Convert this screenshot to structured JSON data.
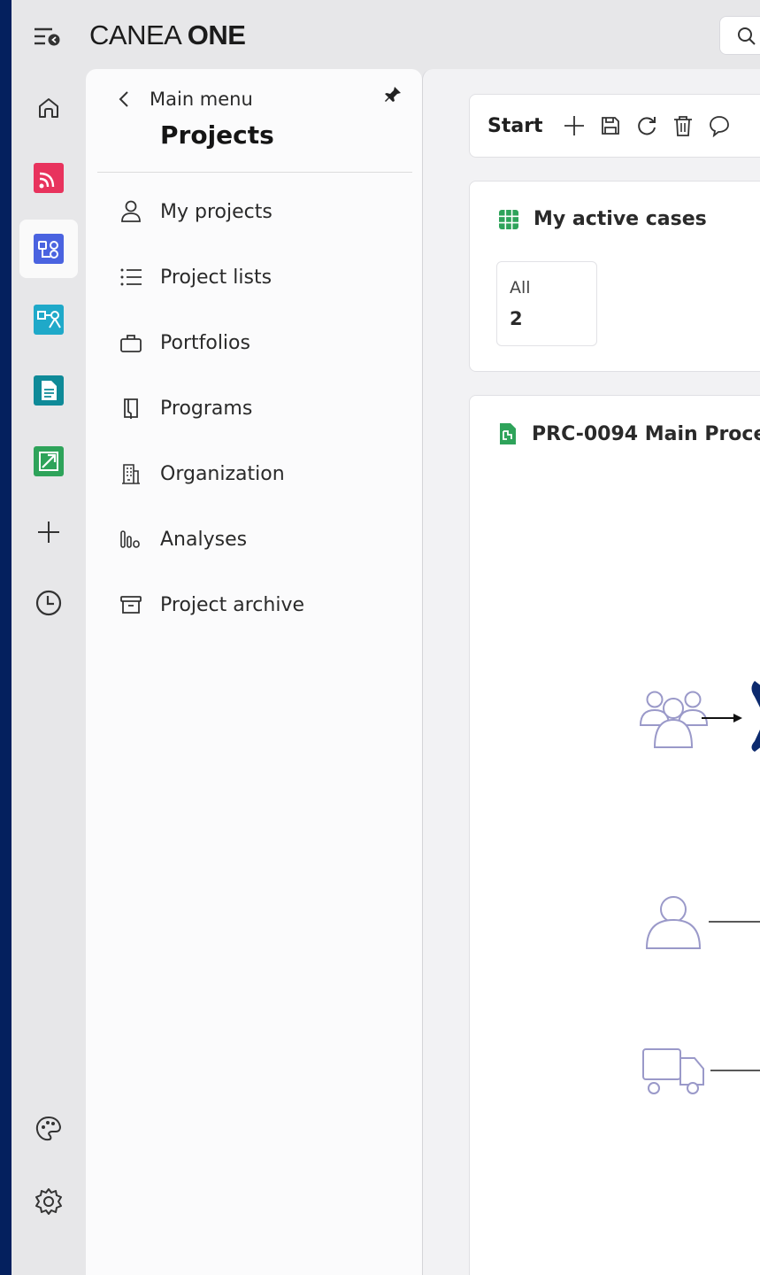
{
  "brand": {
    "name_light": "CANEA ",
    "name_bold": "ONE"
  },
  "search": {
    "icon": "search-icon"
  },
  "rail": {
    "items": [
      {
        "name": "home",
        "icon": "home-icon"
      },
      {
        "name": "feed-app",
        "icon": "rss-icon",
        "color": "#e8335d"
      },
      {
        "name": "projects-app",
        "icon": "projects-icon",
        "color": "#4a63e0",
        "active": true
      },
      {
        "name": "process-app",
        "icon": "process-icon",
        "color": "#1fa9c9"
      },
      {
        "name": "documents-app",
        "icon": "document-icon",
        "color": "#0f8a98"
      },
      {
        "name": "improvement-app",
        "icon": "improvement-icon",
        "color": "#2ea35a"
      },
      {
        "name": "add",
        "icon": "plus-icon"
      },
      {
        "name": "history",
        "icon": "clock-icon"
      }
    ],
    "bottom": [
      {
        "name": "theme",
        "icon": "palette-icon"
      },
      {
        "name": "settings",
        "icon": "gear-icon"
      }
    ]
  },
  "nav": {
    "back_label": "Main menu",
    "title": "Projects",
    "items": [
      {
        "label": "My projects",
        "icon": "user-icon"
      },
      {
        "label": "Project lists",
        "icon": "list-icon"
      },
      {
        "label": "Portfolios",
        "icon": "briefcase-icon"
      },
      {
        "label": "Programs",
        "icon": "book-icon"
      },
      {
        "label": "Organization",
        "icon": "building-icon"
      },
      {
        "label": "Analyses",
        "icon": "bar-chart-icon"
      },
      {
        "label": "Project archive",
        "icon": "archive-icon"
      }
    ]
  },
  "toolbar": {
    "start_label": "Start"
  },
  "cases": {
    "title": "My active cases",
    "stat_label": "All",
    "stat_value": "2"
  },
  "process": {
    "title": "PRC-0094 Main Proce"
  },
  "colors": {
    "accent_green": "#2ea35a",
    "diagram_navy": "#0c2a6e",
    "icon_purple": "#9a99c9"
  }
}
